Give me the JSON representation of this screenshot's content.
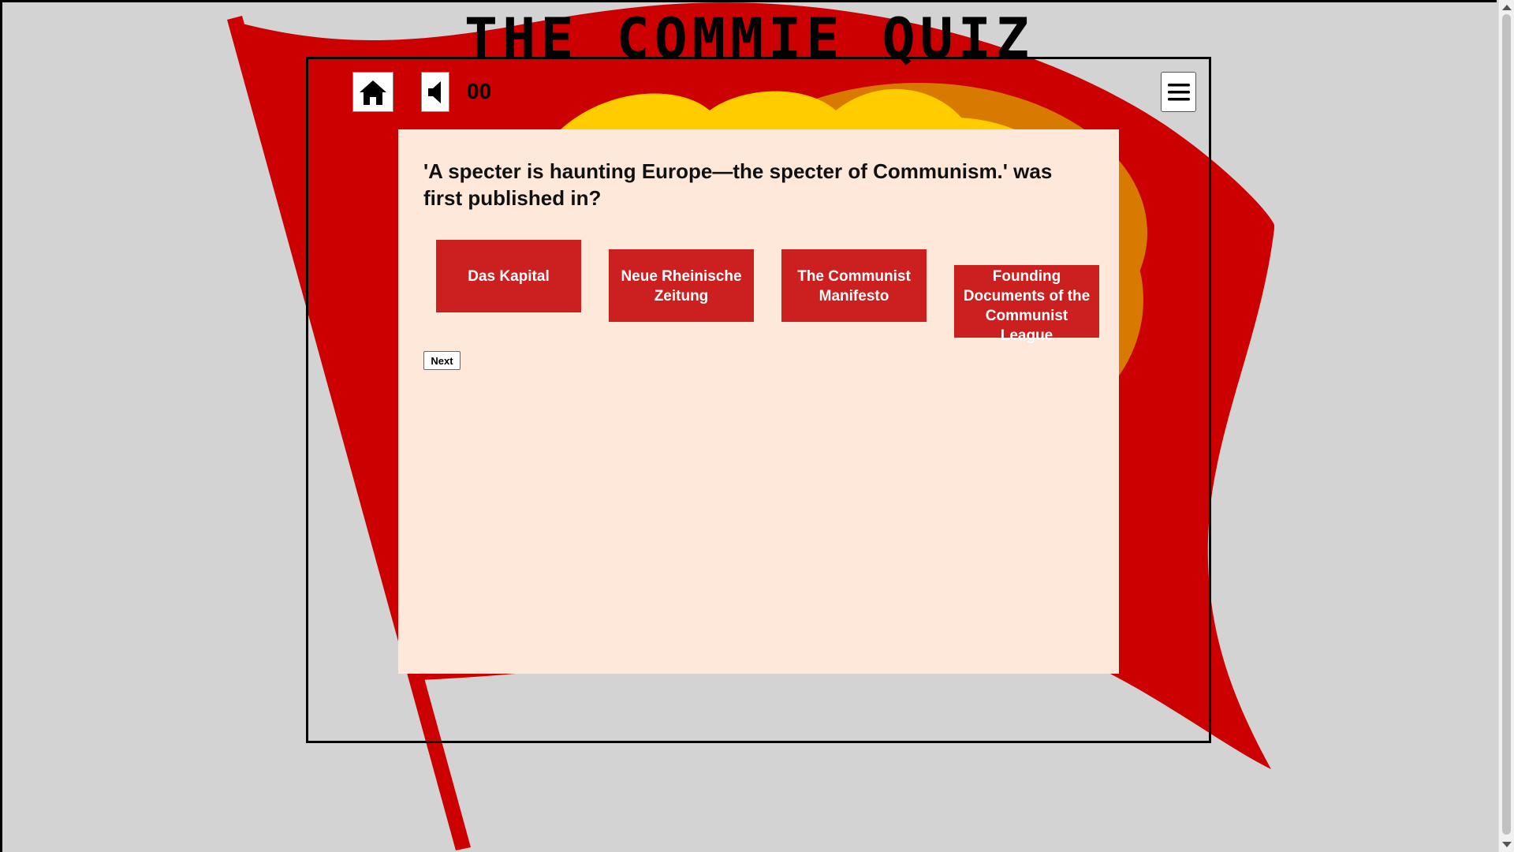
{
  "app": {
    "title": "THE COMMIE QUIZ"
  },
  "header": {
    "home_icon": "home-icon",
    "sound_icon": "speaker-icon",
    "menu_icon": "hamburger-menu-icon",
    "score": "00"
  },
  "quiz": {
    "question": "'A specter is haunting Europe—the specter of Communism.' was first published in?",
    "answers": [
      "Das Kapital",
      "Neue Rheinische Zeitung",
      "The Communist Manifesto",
      "Founding Documents of the Communist League"
    ],
    "next_label": "Next"
  },
  "colors": {
    "flag_red": "#cc0000",
    "answer_red": "#cc1f1f",
    "card_bg": "#fde8da",
    "page_bg": "#d3d3d3",
    "emblem_gold": "#ffcc00",
    "emblem_orange": "#d97a00"
  }
}
